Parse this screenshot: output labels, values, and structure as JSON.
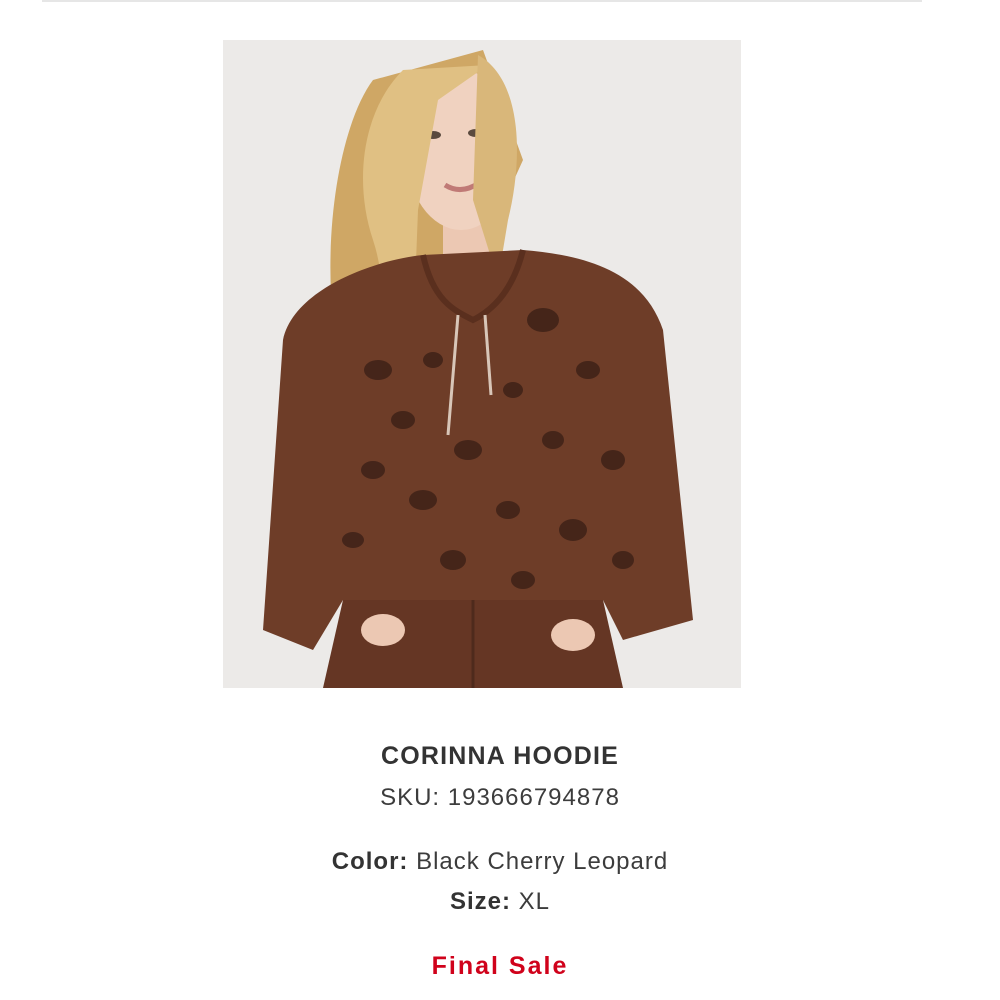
{
  "product": {
    "image_alt": "Woman wearing brown leopard print hoodie and matching joggers",
    "name": "CORINNA HOODIE",
    "sku_label": "SKU:",
    "sku_value": "193666794878",
    "color_label": "Color:",
    "color_value": "Black Cherry Leopard",
    "size_label": "Size:",
    "size_value": "XL",
    "sale_status": "Final Sale"
  },
  "colors": {
    "sale_text": "#d0021b",
    "garment": "#6e3d28",
    "spots": "#3e2117",
    "hair": "#d9b77a",
    "skin": "#f0d2c0",
    "background": "#eceae8"
  },
  "icons": {
    "product_image": "product-photo"
  }
}
